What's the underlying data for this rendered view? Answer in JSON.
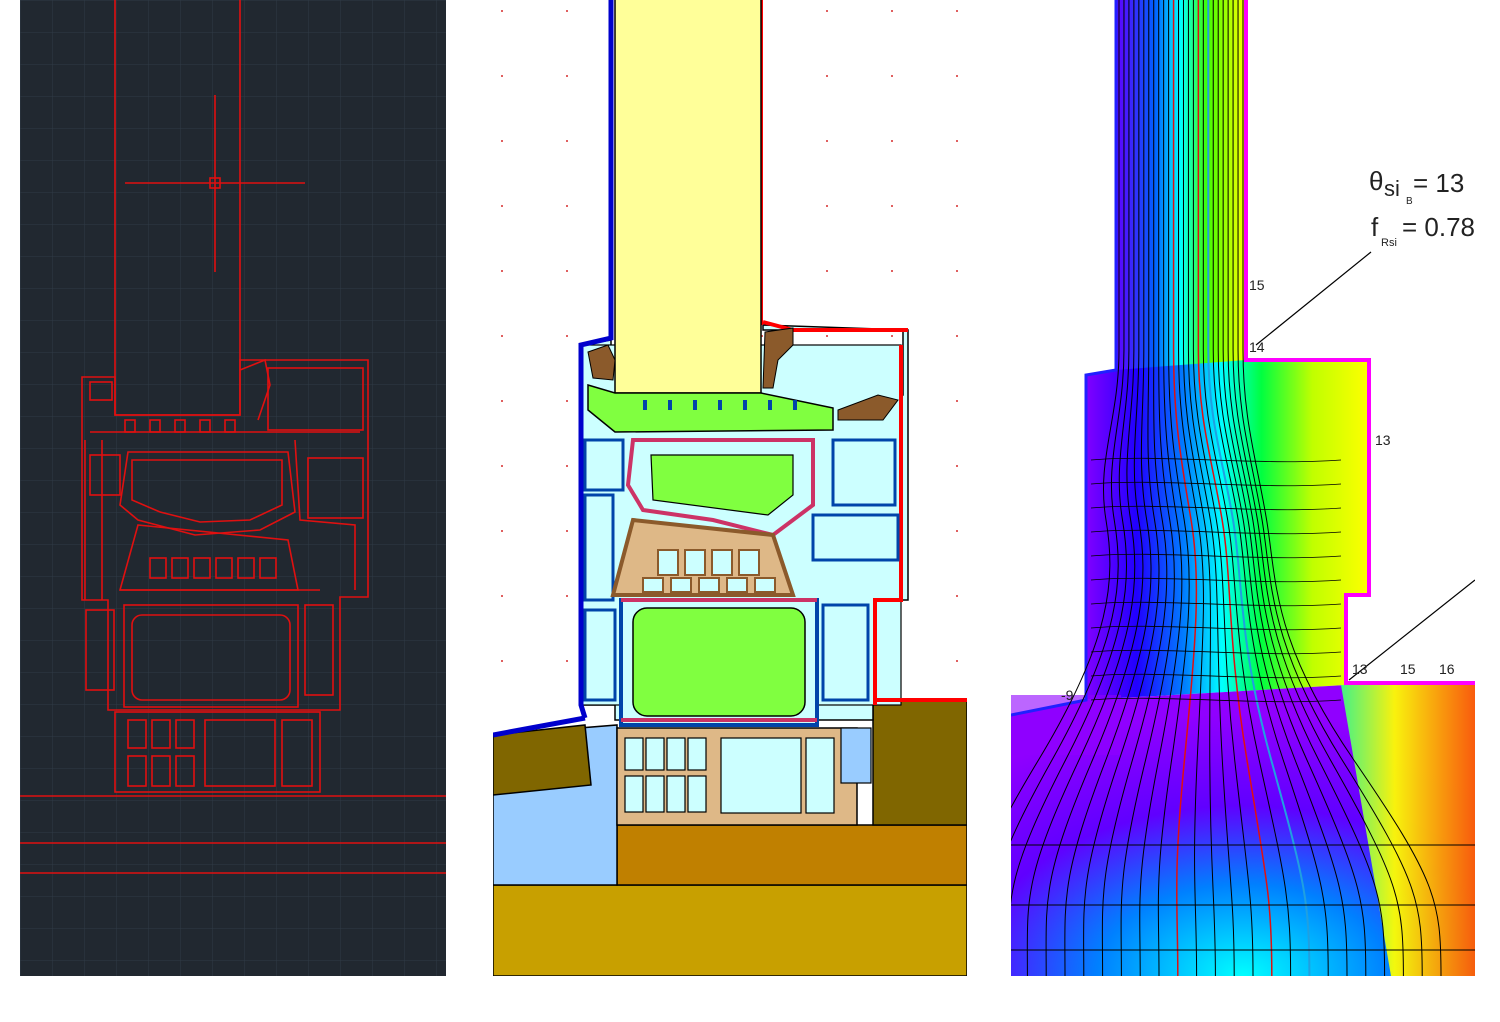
{
  "panels": [
    {
      "id": "cad",
      "kind": "CAD drawing (dark background, red linework)"
    },
    {
      "id": "materials",
      "kind": "material assignment cross-section"
    },
    {
      "id": "thermal",
      "kind": "isotherm / temperature field result"
    }
  ],
  "thermal": {
    "theta_symbol": "θ",
    "theta_sub": "si",
    "theta_subsub": "B",
    "theta_value": "= 13",
    "f_symbol": "f",
    "f_sub": "Rsi",
    "f_value": "= 0.78",
    "isotherm_labels": [
      "15",
      "14",
      "13",
      "-9",
      "13",
      "15",
      "16"
    ]
  },
  "colors": {
    "cad_background": "#212830",
    "cad_line": "#e01010",
    "glass": "#ffff99",
    "profile_fill": "#ccffff",
    "insulation_green": "#80ff40",
    "gasket_brown": "#8b5a2b",
    "wall_brown": "#806600",
    "screed": "#c08000",
    "floor": "#c8a000",
    "interior_edge": "#ff0000",
    "exterior_edge": "#0000cc",
    "light_blue": "#99ccff"
  }
}
